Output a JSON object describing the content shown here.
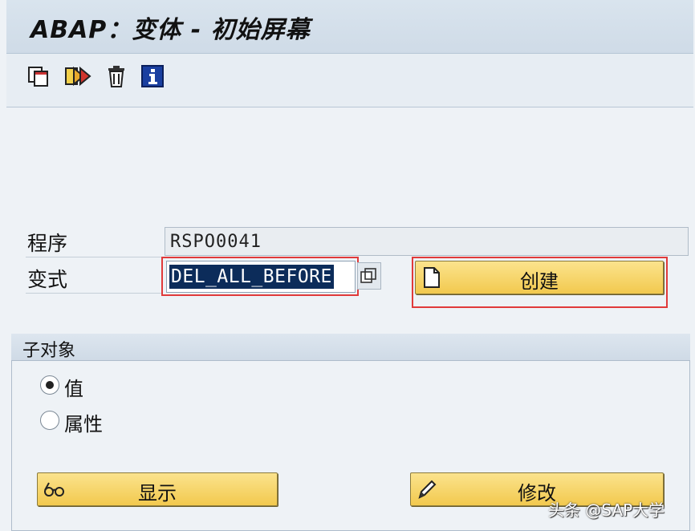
{
  "window": {
    "title": "ABAP：变体 - 初始屏幕"
  },
  "toolbar": {
    "icons": [
      "copy-icon",
      "rename-icon",
      "delete-icon",
      "info-icon"
    ]
  },
  "form": {
    "program_label": "程序",
    "program_value": "RSPO0041",
    "variant_label": "变式",
    "variant_value": "DEL_ALL_BEFORE",
    "create_button": "创建"
  },
  "subobjects": {
    "title": "子对象",
    "options": [
      {
        "label": "值",
        "selected": true
      },
      {
        "label": "属性",
        "selected": false
      }
    ],
    "display_button": "显示",
    "change_button": "修改"
  },
  "watermark": "头条 @SAP大学",
  "colors": {
    "button_yellow": "#f2c94e",
    "highlight_red": "#e03a3a",
    "selection_navy": "#0c2c5a",
    "title_bar": "#d9e4ee"
  }
}
